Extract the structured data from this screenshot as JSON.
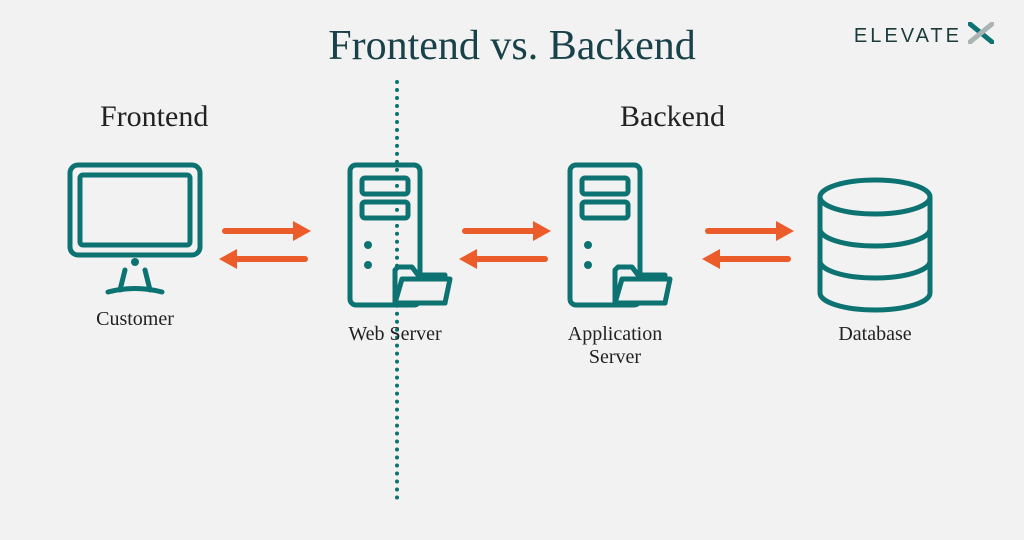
{
  "brand": {
    "name": "ELEVATE",
    "mark": "X"
  },
  "title": "Frontend vs. Backend",
  "sections": {
    "frontend": "Frontend",
    "backend": "Backend"
  },
  "nodes": {
    "customer": "Customer",
    "web": "Web Server",
    "app": "Application Server",
    "db": "Database"
  },
  "colors": {
    "teal": "#0d7272",
    "orange": "#ec5b2a",
    "ink": "#19414a"
  }
}
